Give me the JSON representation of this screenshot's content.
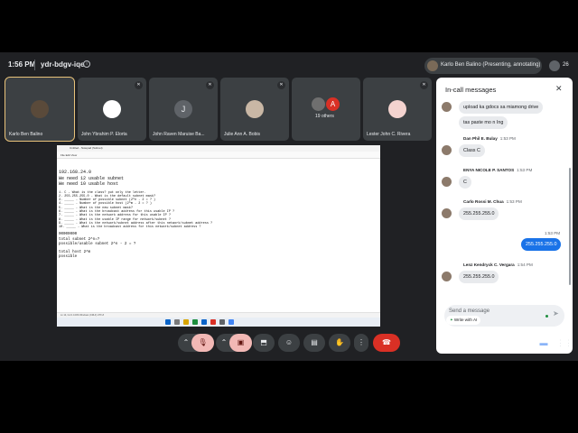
{
  "topbar": {
    "time": "1:56 PM",
    "meeting_code": "ydr-bdgv-iqe",
    "presenter_label": "Karlo Ben Balino (Presenting, annotating)",
    "people_count": "26"
  },
  "tiles": [
    {
      "name": "Karlo Ben Balino",
      "avatar_color": "#5a4a3a"
    },
    {
      "name": "John Ybrahim P. Elorta",
      "avatar_color": "#ffffff"
    },
    {
      "name": "John Raven Maruise Ba...",
      "avatar_letter": "J",
      "avatar_color": "#5f6368"
    },
    {
      "name": "Julie Ann A. Bobis",
      "avatar_color": "#c9b7a5"
    },
    {
      "others_label": "19 others",
      "others_letter": "A"
    },
    {
      "name": "Lester John C. Rivera",
      "avatar_color": "#f4d3cf"
    }
  ],
  "shared_screen": {
    "window_title": "Untitled - Notepad (Subnet)",
    "menu": "File   Edit   View",
    "lines_big": [
      "192.168.24.0",
      "We need 12 usable subnet",
      "We need 10 usable host"
    ],
    "lines_questions": [
      "1. C - What is the class? put only the letter.",
      "2. 255.255.255.0 - What is the default subnet mask?",
      "3. _____ - Number of possible subnet (2^n - 2 = ? )",
      "4. _____ - Number of possible host (2^m - 2 = ? )",
      "5. _____ - What is the new subnet mask?",
      "6. _____ - What is the broadcast address for this usable IP ?",
      "7. _____ - What is the network address for this usable IP ?",
      "8. _____ - What is the usable IP range for network/subnet ?",
      "9. _____ - What is the network/subnet address after this network/subnet address ?",
      "10. _____ - What is the broadcast address for this network/subnet address ?"
    ],
    "lines_notes": [
      "00000000",
      "total subnet 2^n=?",
      "possible/usable subnet 2^n - 2 = ?"
    ],
    "lines_host": [
      "total host 2^m",
      "possible"
    ],
    "status": "Ln 14, Col 1     100%     Windows (CRLF)     UTF-8"
  },
  "controls": {
    "mic_icon": "mic-off-icon",
    "camera_icon": "camera-off-icon",
    "present_icon": "present-icon",
    "emoji_icon": "emoji-icon",
    "captions_icon": "captions-icon",
    "hand_icon": "raise-hand-icon",
    "more_icon": "more-vert-icon",
    "hangup_icon": "hangup-icon"
  },
  "chat": {
    "title": "In-call messages",
    "messages": [
      {
        "text": "upload ka gdocs sa miamong drive"
      },
      {
        "text": "tas paste mo n Ing"
      },
      {
        "sender": "Dan Phil E. Bulay",
        "time": "1:53 PM",
        "text": "Class C"
      },
      {
        "sender": "ENYA NICOLE P. SANTOS",
        "time": "1:53 PM",
        "text": "C"
      },
      {
        "sender": "Carlo Rossi M. Chua",
        "time": "1:53 PM",
        "text": "255.255.255.0"
      },
      {
        "me_time": "1:53 PM",
        "text": "255.255.255.0"
      },
      {
        "sender": "Lenz Kendryck C. Vergara",
        "time": "1:54 PM",
        "text": "255.255.255.0"
      }
    ],
    "compose_placeholder": "Send a message",
    "write_with_ai": "Write with AI"
  },
  "colors": {
    "meet_bg": "#202124",
    "accent_blue": "#1a73e8",
    "hangup_red": "#d93025"
  }
}
